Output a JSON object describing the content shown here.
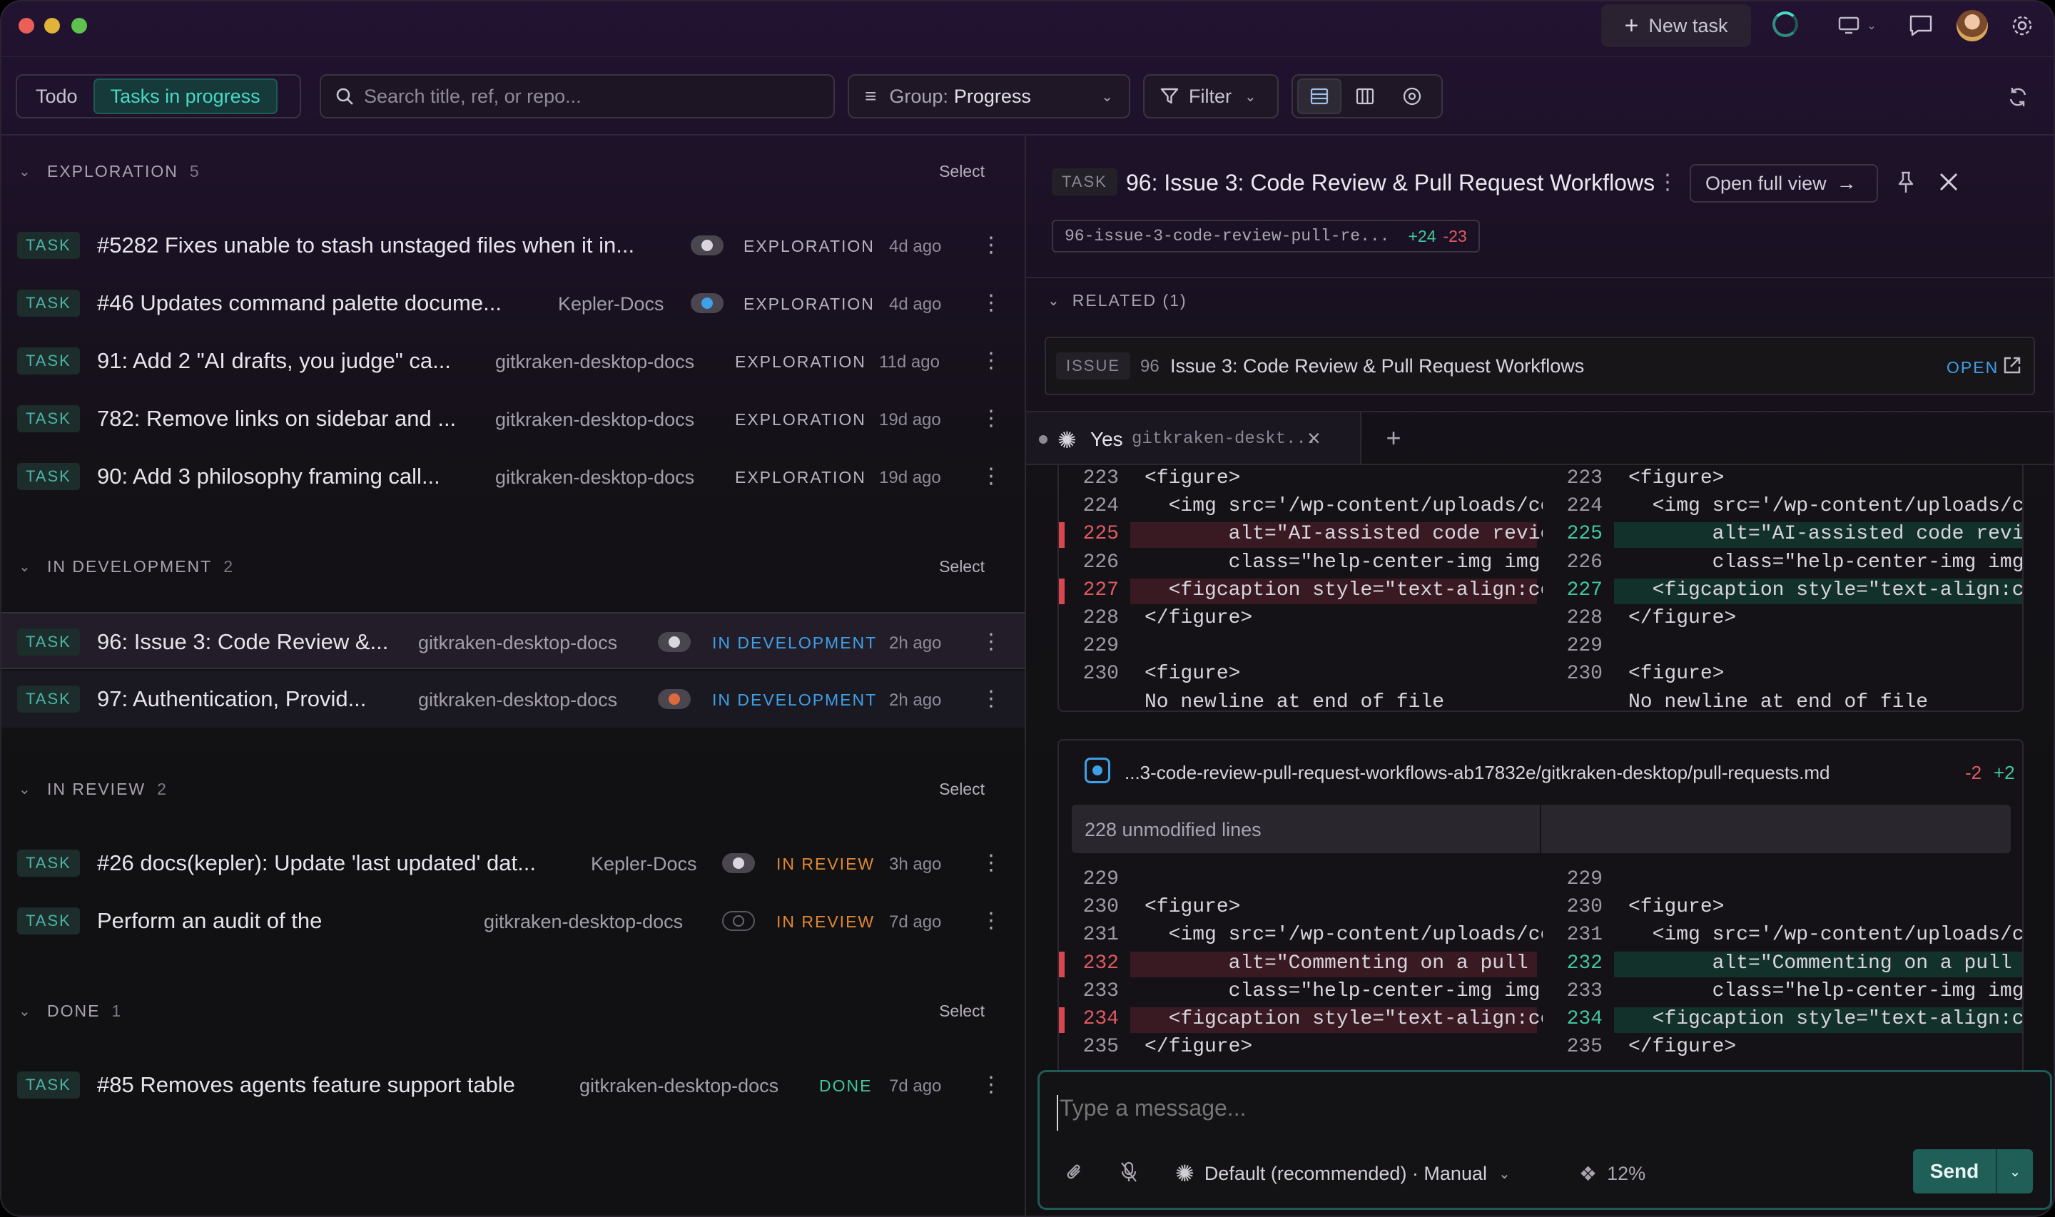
{
  "titlebar": {
    "new_task_label": "New task"
  },
  "toolbar": {
    "tab_todo": "Todo",
    "tab_in_progress": "Tasks in progress",
    "search_placeholder": "Search title, ref, or repo...",
    "group_prefix": "Group:",
    "group_value": "Progress",
    "filter_label": "Filter"
  },
  "groups": [
    {
      "label": "EXPLORATION",
      "count": "5",
      "select": "Select"
    },
    {
      "label": "IN DEVELOPMENT",
      "count": "2",
      "select": "Select"
    },
    {
      "label": "IN REVIEW",
      "count": "2",
      "select": "Select"
    },
    {
      "label": "DONE",
      "count": "1",
      "select": "Select"
    }
  ],
  "tasks": [
    {
      "tag": "TASK",
      "title": "#5282 Fixes unable to stash unstaged files when it in...",
      "repo": "",
      "status": "EXPLORATION",
      "ago": "4d ago"
    },
    {
      "tag": "TASK",
      "title": "#46 Updates command palette docume...",
      "repo": "Kepler-Docs",
      "status": "EXPLORATION",
      "ago": "4d ago"
    },
    {
      "tag": "TASK",
      "title": "91: Add 2 \"AI drafts, you judge\" ca...",
      "repo": "gitkraken-desktop-docs",
      "status": "EXPLORATION",
      "ago": "11d ago"
    },
    {
      "tag": "TASK",
      "title": "782: Remove links on sidebar and ...",
      "repo": "gitkraken-desktop-docs",
      "status": "EXPLORATION",
      "ago": "19d ago"
    },
    {
      "tag": "TASK",
      "title": "90: Add 3 philosophy framing call...",
      "repo": "gitkraken-desktop-docs",
      "status": "EXPLORATION",
      "ago": "19d ago"
    },
    {
      "tag": "TASK",
      "title": "96: Issue 3: Code Review &...",
      "repo": "gitkraken-desktop-docs",
      "status": "IN DEVELOPMENT",
      "ago": "2h ago"
    },
    {
      "tag": "TASK",
      "title": "97: Authentication, Provid...",
      "repo": "gitkraken-desktop-docs",
      "status": "IN DEVELOPMENT",
      "ago": "2h ago"
    },
    {
      "tag": "TASK",
      "title": "#26 docs(kepler): Update 'last updated' dat...",
      "repo": "Kepler-Docs",
      "status": "IN REVIEW",
      "ago": "3h ago"
    },
    {
      "tag": "TASK",
      "title": "Perform an audit of the",
      "repo": "gitkraken-desktop-docs",
      "status": "IN REVIEW",
      "ago": "7d ago"
    },
    {
      "tag": "TASK",
      "title": "#85 Removes agents feature support table",
      "repo": "gitkraken-desktop-docs",
      "status": "DONE",
      "ago": "7d ago"
    }
  ],
  "colors": {
    "accent": "#49d8c6",
    "exploration": "#b9b4c1",
    "in_development": "#3ea0e6",
    "in_review": "#e0892f",
    "done": "#3fc79e",
    "delete": "#d9464e",
    "add": "#3fc79e"
  },
  "detail": {
    "tag": "TASK",
    "title": "96: Issue 3: Code Review & Pull Request Workflows",
    "open_full_view": "Open full view",
    "branch": "96-issue-3-code-review-pull-re...",
    "additions": "+24",
    "deletions": "-23",
    "related_label": "RELATED (1)",
    "related": {
      "tag": "ISSUE",
      "number": "96",
      "title": "Issue 3: Code Review & Pull Request Workflows",
      "state": "OPEN"
    },
    "session_tab": {
      "label": "Yes",
      "repo": "gitkraken-deskt..."
    }
  },
  "diff1": {
    "left": [
      {
        "n": "223",
        "t": "<figure>",
        "k": ""
      },
      {
        "n": "224",
        "t": "  <img src='/wp-content/uploads/co",
        "k": ""
      },
      {
        "n": "225",
        "t": "       alt=\"AI-assisted code revie",
        "k": "del"
      },
      {
        "n": "226",
        "t": "       class=\"help-center-img img-l",
        "k": ""
      },
      {
        "n": "227",
        "t": "  <figcaption style=\"text-align:ce",
        "k": "del"
      },
      {
        "n": "228",
        "t": "</figure>",
        "k": ""
      },
      {
        "n": "229",
        "t": "",
        "k": ""
      },
      {
        "n": "230",
        "t": "<figure>",
        "k": ""
      },
      {
        "n": "",
        "t": "No newline at end of file",
        "k": ""
      }
    ],
    "right": [
      {
        "n": "223",
        "t": "<figure>",
        "k": ""
      },
      {
        "n": "224",
        "t": "  <img src='/wp-content/uploads/co",
        "k": ""
      },
      {
        "n": "225",
        "t": "       alt=\"AI-assisted code revie",
        "k": "add"
      },
      {
        "n": "226",
        "t": "       class=\"help-center-img img-l",
        "k": ""
      },
      {
        "n": "227",
        "t": "  <figcaption style=\"text-align:ce",
        "k": "add"
      },
      {
        "n": "228",
        "t": "</figure>",
        "k": ""
      },
      {
        "n": "229",
        "t": "",
        "k": ""
      },
      {
        "n": "230",
        "t": "<figure>",
        "k": ""
      },
      {
        "n": "",
        "t": "No newline at end of file",
        "k": ""
      }
    ]
  },
  "diff2": {
    "file": "...3-code-review-pull-request-workflows-ab17832e/gitkraken-desktop/pull-requests.md",
    "deletions": "-2",
    "additions": "+2",
    "unmodified": "228 unmodified lines",
    "left": [
      {
        "n": "229",
        "t": "",
        "k": ""
      },
      {
        "n": "230",
        "t": "<figure>",
        "k": ""
      },
      {
        "n": "231",
        "t": "  <img src='/wp-content/uploads/co",
        "k": ""
      },
      {
        "n": "232",
        "t": "       alt=\"Commenting on a pull r",
        "k": "del"
      },
      {
        "n": "233",
        "t": "       class=\"help-center-img img-l",
        "k": ""
      },
      {
        "n": "234",
        "t": "  <figcaption style=\"text-align:ce",
        "k": "del"
      },
      {
        "n": "235",
        "t": "</figure>",
        "k": ""
      }
    ],
    "right": [
      {
        "n": "229",
        "t": "",
        "k": ""
      },
      {
        "n": "230",
        "t": "<figure>",
        "k": ""
      },
      {
        "n": "231",
        "t": "  <img src='/wp-content/uploads/co",
        "k": ""
      },
      {
        "n": "232",
        "t": "       alt=\"Commenting on a pull r",
        "k": "add"
      },
      {
        "n": "233",
        "t": "       class=\"help-center-img img-l",
        "k": ""
      },
      {
        "n": "234",
        "t": "  <figcaption style=\"text-align:ce",
        "k": "add"
      },
      {
        "n": "235",
        "t": "</figure>",
        "k": ""
      }
    ]
  },
  "composer": {
    "placeholder": "Type a message...",
    "model": "Default (recommended) · Manual",
    "context": "12%",
    "send": "Send"
  }
}
